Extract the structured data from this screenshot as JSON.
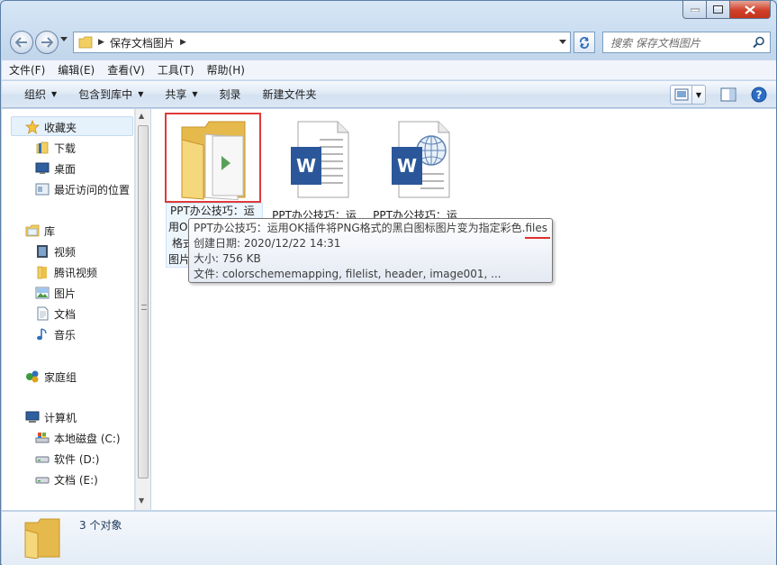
{
  "window": {
    "address_path": "保存文档图片",
    "search_placeholder": "搜索 保存文档图片"
  },
  "menu": [
    "文件(F)",
    "编辑(E)",
    "查看(V)",
    "工具(T)",
    "帮助(H)"
  ],
  "commands": {
    "organize": "组织",
    "include_in_library": "包含到库中",
    "share": "共享",
    "burn": "刻录",
    "new_folder": "新建文件夹"
  },
  "nav": {
    "favorites": {
      "label": "收藏夹",
      "items": [
        "下载",
        "桌面",
        "最近访问的位置"
      ]
    },
    "libraries": {
      "label": "库",
      "items": [
        "视频",
        "腾讯视频",
        "图片",
        "文档",
        "音乐"
      ]
    },
    "homegroup": "家庭组",
    "computer": {
      "label": "计算机",
      "items": [
        "本地磁盘 (C:)",
        "软件 (D:)",
        "文档 (E:)"
      ]
    }
  },
  "files": [
    {
      "type": "folder",
      "label_lines": [
        "PPT办公技巧：运",
        "用O",
        "格式",
        "图片"
      ]
    },
    {
      "type": "word",
      "label": "PPT办公技巧：运"
    },
    {
      "type": "word-web",
      "label": "PPT办公技巧：运"
    }
  ],
  "tooltip": {
    "name": "PPT办公技巧：运用OK插件将PNG格式的黑白图标图片变为指定彩色.files",
    "created": "创建日期: 2020/12/22 14:31",
    "size": "大小: 756 KB",
    "files": "文件: colorschememapping, filelist, header, image001, ..."
  },
  "status": {
    "count": "3 个对象"
  },
  "colors": {
    "highlight_border": "#e03a3a",
    "word_blue": "#2b579a",
    "folder_yellow": "#f2cf63"
  }
}
